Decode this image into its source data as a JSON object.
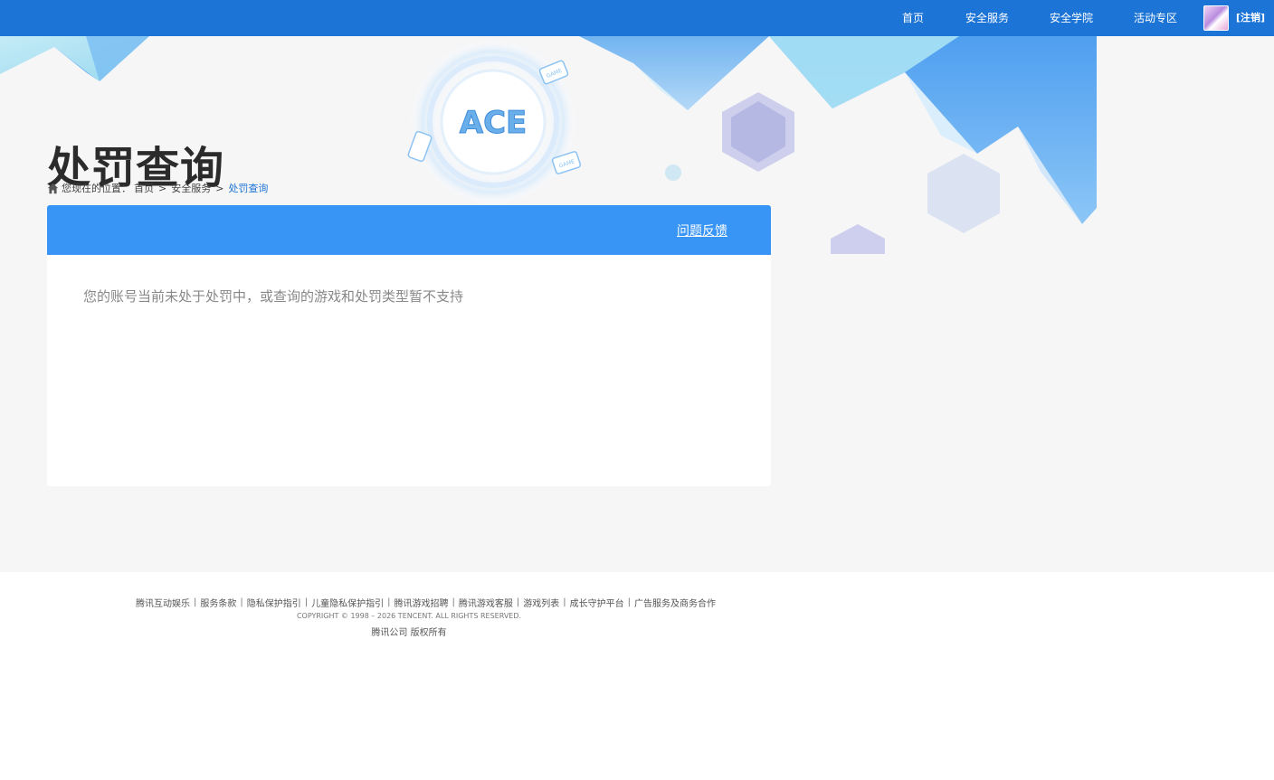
{
  "nav": {
    "items": [
      {
        "label": "首页"
      },
      {
        "label": "安全服务"
      },
      {
        "label": "安全学院"
      },
      {
        "label": "活动专区"
      }
    ],
    "logout_label": "[注销]"
  },
  "hero": {
    "title": "处罚查询",
    "logo_text": "ACE",
    "card_text": "GAME"
  },
  "breadcrumb": {
    "prefix": "您现在的位置：",
    "items": [
      "首页",
      "安全服务"
    ],
    "separator": ">",
    "current": "处罚查询"
  },
  "panel": {
    "feedback_label": "问题反馈",
    "message": "您的账号当前未处于处罚中，或查询的游戏和处罚类型暂不支持"
  },
  "footer": {
    "links": [
      "腾讯互动娱乐",
      "服务条款",
      "隐私保护指引",
      "儿童隐私保护指引",
      "腾讯游戏招聘",
      "腾讯游戏客服",
      "游戏列表",
      "成长守护平台",
      "广告服务及商务合作"
    ],
    "separator": "|",
    "copyright": "COPYRIGHT © 1998 – 2026 TENCENT. ALL RIGHTS RESERVED.",
    "company": "腾讯公司 版权所有"
  },
  "colors": {
    "nav_bg": "#1c74d6",
    "panel_head": "#3894f5",
    "page_bg": "#f6f6f7",
    "breadcrumb_current": "#1c74d6"
  }
}
